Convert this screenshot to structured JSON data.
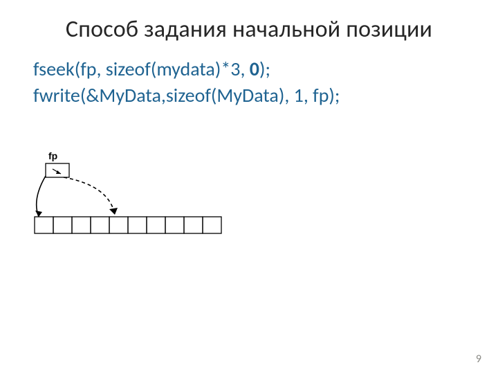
{
  "title": "Cпособ задания начальной позиции",
  "code": {
    "line1_left": "fseek(fp, sizeof(mydata)*3, ",
    "line1_bold": "0",
    "line1_right": ");",
    "line2": "fwrite(&MyData,sizeof(MyData), 1, fp);"
  },
  "diagram": {
    "fp_label": "fp"
  },
  "page_number": "9"
}
